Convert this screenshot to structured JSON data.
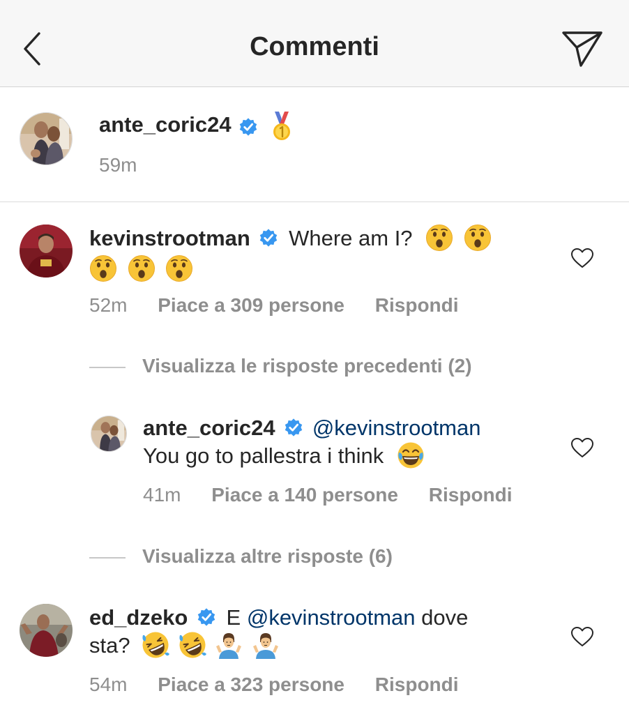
{
  "header": {
    "title": "Commenti"
  },
  "caption": {
    "username": "ante_coric24",
    "time": "59m"
  },
  "comments": [
    {
      "username": "kevinstrootman",
      "text": "Where am I?",
      "time": "52m",
      "likes": "Piace a 309 persone",
      "reply": "Rispondi"
    },
    {
      "username": "ante_coric24",
      "mention": "@kevinstrootman",
      "text": "You go to pallestra i think",
      "time": "41m",
      "likes": "Piace a 140 persone",
      "reply": "Rispondi"
    },
    {
      "username": "ed_dzeko",
      "text_pre": "E",
      "mention": "@kevinstrootman",
      "text_post": "dove",
      "text_line2": "sta?",
      "time": "54m",
      "likes": "Piace a 323 persone",
      "reply": "Rispondi"
    }
  ],
  "view_previous": "Visualizza le risposte precedenti (2)",
  "view_more": "Visualizza altre risposte (6)",
  "colors": {
    "verified": "#3897f0",
    "mention": "#003569",
    "meta": "#8e8e8e"
  }
}
